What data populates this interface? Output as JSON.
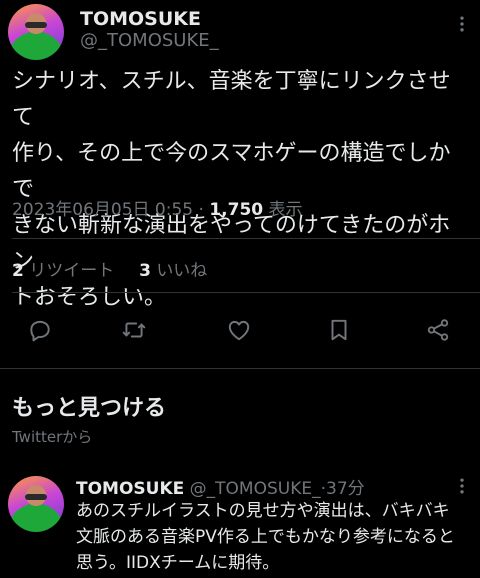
{
  "tweet": {
    "author_name": "TOMOSUKE",
    "author_handle": "@_TOMOSUKE_",
    "text": "シナリオ、スチル、音楽を丁寧にリンクさせて\n作り、その上で今のスマホゲーの構造でしかで\nきない斬新な演出をやってのけてきたのがホン\nトおそろしい。",
    "timestamp": "2023年06月05日 0:55",
    "separator": "·",
    "views": "1,750",
    "views_label": "表示",
    "retweets": "2",
    "retweets_label": "リツイート",
    "likes": "3",
    "likes_label": "いいね"
  },
  "actions": [
    {
      "icon": "reply-icon"
    },
    {
      "icon": "retweet-icon"
    },
    {
      "icon": "like-icon"
    },
    {
      "icon": "bookmark-icon"
    },
    {
      "icon": "share-icon"
    }
  ],
  "discover": {
    "title": "もっと見つける",
    "source": "Twitterから"
  },
  "recommended": {
    "author_name": "TOMOSUKE",
    "author_handle": "@_TOMOSUKE_",
    "separator": "·",
    "time": "37分",
    "text": "あのスチルイラストの見せ方や演出は、バキバキ\n文脈のある音楽PV作る上でもかなり参考になると\n思う。IIDXチームに期待。"
  },
  "colors": {
    "background": "#000000",
    "text": "#e7e9ea",
    "secondary": "#71767b",
    "divider": "#2f3336"
  }
}
